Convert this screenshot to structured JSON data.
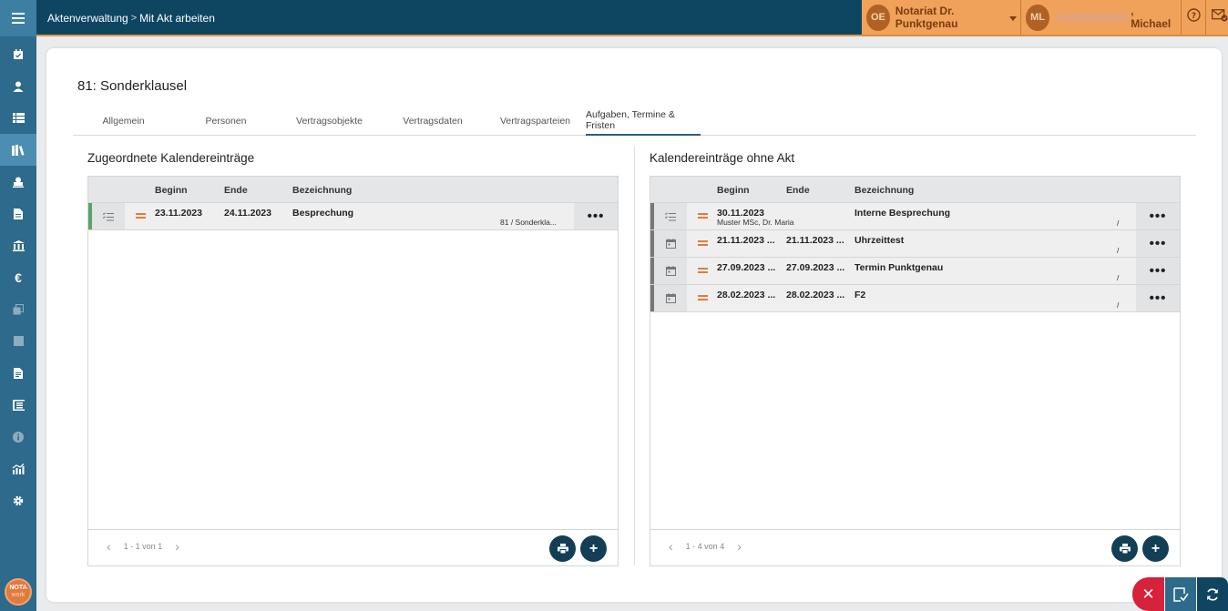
{
  "header": {
    "breadcrumb": [
      "Aktenverwaltung",
      "Mit Akt arbeiten"
    ],
    "office_initials": "OE",
    "office_name": "Notariat Dr. Punktgenau",
    "user_initials": "ML",
    "user_name": ", Michael"
  },
  "page": {
    "title": "81: Sonderklausel",
    "tabs": [
      "Allgemein",
      "Personen",
      "Vertragsobjekte",
      "Vertragsdaten",
      "Vertragsparteien",
      "Aufgaben, Termine & Fristen"
    ],
    "active_tab": "Aufgaben, Termine & Fristen"
  },
  "left_panel": {
    "title": "Zugeordnete Kalendereinträge",
    "columns": [
      "Beginn",
      "Ende",
      "Bezeichnung"
    ],
    "rows": [
      {
        "begin": "23.11.2023",
        "end": "24.11.2023",
        "title": "Besprechung",
        "reference": "81 / Sonderkla...",
        "icon": "task-list-icon",
        "marker": "green"
      }
    ],
    "pagination": "1 - 1 von 1"
  },
  "right_panel": {
    "title": "Kalendereinträge ohne Akt",
    "columns": [
      "Beginn",
      "Ende",
      "Bezeichnung"
    ],
    "rows": [
      {
        "begin": "30.11.2023",
        "end": "",
        "title": "Interne Besprechung",
        "person": "Muster MSc, Dr. Maria",
        "reference": "/",
        "icon": "task-list-icon"
      },
      {
        "begin": "21.11.2023 ...",
        "end": "21.11.2023 ...",
        "title": "Uhrzeittest",
        "person": "",
        "reference": "/",
        "icon": "calendar-icon"
      },
      {
        "begin": "27.09.2023 ...",
        "end": "27.09.2023 ...",
        "title": "Termin Punktgenau",
        "person": "",
        "reference": "/",
        "icon": "calendar-icon"
      },
      {
        "begin": "28.02.2023 ...",
        "end": "28.02.2023 ...",
        "title": "F2",
        "person": "",
        "reference": "/",
        "icon": "calendar-icon"
      }
    ],
    "pagination": "1 - 4 von 4"
  },
  "logo": {
    "line1": "NOTA",
    "line2": "work"
  },
  "colors": {
    "header": "#0e4662",
    "sidebar": "#2d6a8b",
    "accent": "#f0a25a",
    "danger": "#d6223a"
  }
}
